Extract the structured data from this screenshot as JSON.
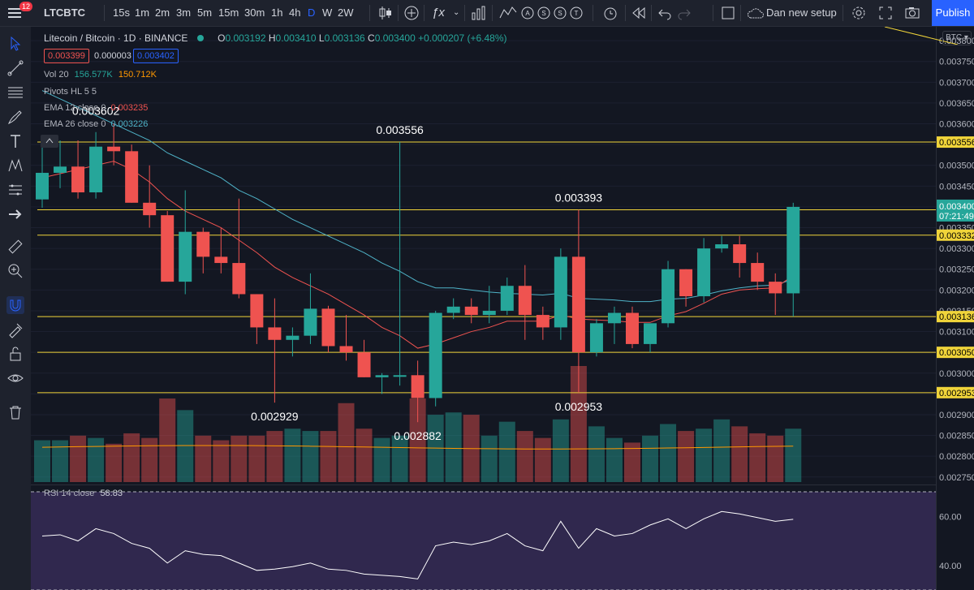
{
  "topbar": {
    "notif_count": "12",
    "symbol": "LTCBTC",
    "intervals": [
      "15s",
      "1m",
      "2m",
      "3m",
      "5m",
      "15m",
      "30m",
      "1h",
      "4h",
      "D",
      "W",
      "2W"
    ],
    "active_interval": "D",
    "layout_name": "Dan new setup",
    "publish_label": "Publish"
  },
  "legend": {
    "title": "Litecoin / Bitcoin · 1D · BINANCE",
    "ohlc": {
      "o_label": "O",
      "o": "0.003192",
      "h_label": "H",
      "h": "0.003410",
      "l_label": "L",
      "l": "0.003136",
      "c_label": "C",
      "c": "0.003400",
      "change": "+0.000207 (+6.48%)"
    },
    "bid": "0.003399",
    "spread": "0.000003",
    "ask": "0.003402",
    "vol": {
      "label": "Vol 20",
      "v1": "156.577K",
      "v2": "150.712K"
    },
    "pivots": "Pivots HL 5 5",
    "ema12": {
      "label": "EMA 12 close 0",
      "value": "0.003235"
    },
    "ema26": {
      "label": "EMA 26 close 0",
      "value": "0.003226"
    },
    "rsi": {
      "label": "RSI 14 close",
      "value": "58.83"
    }
  },
  "colors": {
    "up": "#26a69a",
    "down": "#ef5350",
    "ema12": "#ef5350",
    "ema26": "#4fb3c8",
    "hline": "#f0d43a",
    "rsi_line": "#ffffff",
    "rsi_band": "#7e57c2",
    "accent": "#2962ff"
  },
  "axis": {
    "currency": "BTC",
    "ticks": [
      "0.003800",
      "0.003750",
      "0.003700",
      "0.003650",
      "0.003600",
      "0.003550",
      "0.003500",
      "0.003450",
      "0.003400",
      "0.003350",
      "0.003300",
      "0.003250",
      "0.003200",
      "0.003150",
      "0.003100",
      "0.003050",
      "0.003000",
      "0.002950",
      "0.002900",
      "0.002850",
      "0.002800",
      "0.002750"
    ],
    "price_labels": [
      {
        "text": "0.003556",
        "value": 0.003556
      },
      {
        "text": "0.003393",
        "value": 0.003393
      },
      {
        "text": "0.003332",
        "value": 0.003332
      },
      {
        "text": "0.003136",
        "value": 0.003136
      },
      {
        "text": "0.003050",
        "value": 0.00305
      },
      {
        "text": "0.002953",
        "value": 0.002953
      }
    ],
    "last_price": "0.003400",
    "countdown": "07:21:49",
    "rsi_ticks": [
      "60.00",
      "40.00"
    ]
  },
  "chart_data": {
    "type": "candlestick",
    "y_range": [
      0.00273,
      0.00381
    ],
    "candles": [
      [
        0.003418,
        0.00356,
        0.003398,
        0.003482
      ],
      [
        0.003482,
        0.00356,
        0.003445,
        0.003497
      ],
      [
        0.003497,
        0.00356,
        0.00342,
        0.003435
      ],
      [
        0.003435,
        0.00358,
        0.00342,
        0.003545
      ],
      [
        0.003545,
        0.0036,
        0.0035,
        0.003534
      ],
      [
        0.003534,
        0.00355,
        0.00341,
        0.00341
      ],
      [
        0.00341,
        0.0035,
        0.00335,
        0.00338
      ],
      [
        0.00338,
        0.00339,
        0.00322,
        0.00322
      ],
      [
        0.00322,
        0.00344,
        0.00319,
        0.00334
      ],
      [
        0.00334,
        0.00335,
        0.00324,
        0.00328
      ],
      [
        0.00328,
        0.00335,
        0.00324,
        0.003265
      ],
      [
        0.003265,
        0.00342,
        0.00318,
        0.00319
      ],
      [
        0.00319,
        0.00319,
        0.00307,
        0.00311
      ],
      [
        0.00311,
        0.00318,
        0.002929,
        0.00308
      ],
      [
        0.00308,
        0.00311,
        0.00304,
        0.00309
      ],
      [
        0.00309,
        0.00324,
        0.00307,
        0.003155
      ],
      [
        0.003155,
        0.003162,
        0.00305,
        0.003065
      ],
      [
        0.003065,
        0.00314,
        0.00303,
        0.00305
      ],
      [
        0.00305,
        0.00308,
        0.00299,
        0.00299
      ],
      [
        0.00299,
        0.003,
        0.00295,
        0.002995
      ],
      [
        0.002995,
        0.003556,
        0.00297,
        0.002995
      ],
      [
        0.002995,
        0.00303,
        0.002882,
        0.00294
      ],
      [
        0.00294,
        0.00315,
        0.00292,
        0.003145
      ],
      [
        0.003145,
        0.00318,
        0.00313,
        0.00316
      ],
      [
        0.00316,
        0.00318,
        0.00312,
        0.00314
      ],
      [
        0.00314,
        0.00321,
        0.00312,
        0.00315
      ],
      [
        0.00315,
        0.00323,
        0.00314,
        0.00321
      ],
      [
        0.00321,
        0.00326,
        0.00308,
        0.00314
      ],
      [
        0.00314,
        0.00316,
        0.00308,
        0.00311
      ],
      [
        0.00311,
        0.0033,
        0.00308,
        0.00328
      ],
      [
        0.00328,
        0.003393,
        0.002953,
        0.00305
      ],
      [
        0.00305,
        0.00313,
        0.00304,
        0.00312
      ],
      [
        0.00312,
        0.00316,
        0.00307,
        0.003145
      ],
      [
        0.003145,
        0.00316,
        0.00306,
        0.00307
      ],
      [
        0.00307,
        0.00311,
        0.00305,
        0.00312
      ],
      [
        0.00312,
        0.00327,
        0.00311,
        0.00325
      ],
      [
        0.00325,
        0.00325,
        0.00316,
        0.003185
      ],
      [
        0.003185,
        0.003325,
        0.00317,
        0.0033
      ],
      [
        0.0033,
        0.00333,
        0.00329,
        0.00331
      ],
      [
        0.00331,
        0.00333,
        0.00323,
        0.003265
      ],
      [
        0.003265,
        0.00329,
        0.0032,
        0.00322
      ],
      [
        0.00322,
        0.00324,
        0.00314,
        0.003192
      ],
      [
        0.003192,
        0.00341,
        0.003136,
        0.0034
      ]
    ],
    "volume": [
      0.36,
      0.36,
      0.4,
      0.38,
      0.33,
      0.42,
      0.38,
      0.72,
      0.62,
      0.4,
      0.36,
      0.4,
      0.4,
      0.44,
      0.46,
      0.44,
      0.44,
      0.68,
      0.46,
      0.38,
      0.4,
      0.72,
      0.58,
      0.6,
      0.58,
      0.4,
      0.52,
      0.44,
      0.38,
      0.54,
      1.0,
      0.48,
      0.38,
      0.34,
      0.4,
      0.5,
      0.44,
      0.46,
      0.54,
      0.48,
      0.42,
      0.4,
      0.46
    ],
    "ema12": [
      0.00347,
      0.00348,
      0.00349,
      0.0035,
      0.00351,
      0.00349,
      0.00346,
      0.00342,
      0.00339,
      0.00337,
      0.00335,
      0.00332,
      0.00329,
      0.003255,
      0.00323,
      0.00321,
      0.00319,
      0.003165,
      0.00314,
      0.00311,
      0.00309,
      0.00306,
      0.00307,
      0.003085,
      0.0031,
      0.00311,
      0.003125,
      0.003125,
      0.003125,
      0.00314,
      0.00313,
      0.003128,
      0.003126,
      0.003122,
      0.003122,
      0.003138,
      0.003148,
      0.003168,
      0.00319,
      0.0032,
      0.003203,
      0.003205,
      0.003235
    ],
    "ema26": [
      0.00368,
      0.00366,
      0.00364,
      0.00362,
      0.0036,
      0.00358,
      0.00356,
      0.00353,
      0.00351,
      0.00349,
      0.00347,
      0.00344,
      0.00342,
      0.003395,
      0.00337,
      0.00335,
      0.00333,
      0.00331,
      0.00329,
      0.003265,
      0.003245,
      0.00322,
      0.003205,
      0.003205,
      0.0032,
      0.003195,
      0.003192,
      0.00319,
      0.003188,
      0.003192,
      0.00318,
      0.003178,
      0.003176,
      0.003172,
      0.003172,
      0.003178,
      0.00318,
      0.003188,
      0.003198,
      0.003205,
      0.00321,
      0.003212,
      0.003226
    ],
    "rsi": [
      52.0,
      52.5,
      50.0,
      55.0,
      53.0,
      49.0,
      47.0,
      41.0,
      46.0,
      44.5,
      44.0,
      41.0,
      38.0,
      38.5,
      39.5,
      41.0,
      38.5,
      38.0,
      36.5,
      36.0,
      35.5,
      34.5,
      48.0,
      49.5,
      48.5,
      50.0,
      53.0,
      48.0,
      46.0,
      58.0,
      47.0,
      55.0,
      52.0,
      53.0,
      56.5,
      59.0,
      55.0,
      59.0,
      62.0,
      61.0,
      59.5,
      58.0,
      58.83
    ],
    "rsi_range": [
      30,
      72
    ],
    "rsi_bands": [
      70,
      30
    ],
    "pivot_labels": [
      {
        "text": "0.003602",
        "index": 3,
        "value": 0.003602,
        "pos": "high"
      },
      {
        "text": "0.003556",
        "index": 20,
        "value": 0.003556,
        "pos": "high"
      },
      {
        "text": "0.003393",
        "index": 30,
        "value": 0.003393,
        "pos": "high"
      },
      {
        "text": "0.002929",
        "index": 13,
        "value": 0.002929,
        "pos": "low"
      },
      {
        "text": "0.002882",
        "index": 21,
        "value": 0.002882,
        "pos": "low"
      },
      {
        "text": "0.002953",
        "index": 30,
        "value": 0.002953,
        "pos": "low"
      }
    ],
    "hlines": [
      0.003556,
      0.003393,
      0.003332,
      0.003136,
      0.00305,
      0.002953
    ]
  }
}
